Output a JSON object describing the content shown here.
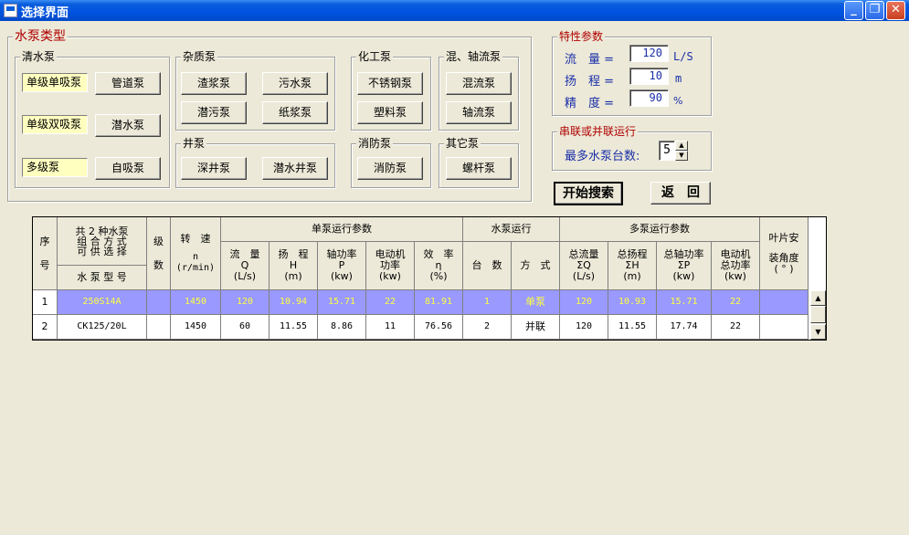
{
  "window": {
    "title": "选择界面",
    "min": "_",
    "max": "❐",
    "close": "✕"
  },
  "pump_type": {
    "title": "水泵类型",
    "clear_water": {
      "title": "清水泵",
      "single_stage_single_suction": "单级单吸泵",
      "single_stage_double_suction": "单级双吸泵",
      "multi_stage": "多级泵",
      "pipeline": "管道泵",
      "submersible": "潜水泵",
      "self_priming": "自吸泵"
    },
    "impurity": {
      "title": "杂质泵",
      "slag": "渣浆泵",
      "sewage": "污水泵",
      "submersible_sewage": "潜污泵",
      "paper_pulp": "纸浆泵"
    },
    "well": {
      "title": "井泵",
      "deep_well": "深井泵",
      "submersible_well": "潜水井泵"
    },
    "chemical": {
      "title": "化工泵",
      "stainless": "不锈钢泵",
      "plastic": "塑料泵"
    },
    "mixed_axial": {
      "title": "混、轴流泵",
      "mixed_flow": "混流泵",
      "axial_flow": "轴流泵"
    },
    "fire": {
      "title": "消防泵",
      "fire_pump": "消防泵"
    },
    "other": {
      "title": "其它泵",
      "screw": "螺杆泵"
    }
  },
  "params": {
    "title": "特性参数",
    "flow": {
      "label": "流　量 =",
      "value": "120",
      "unit": "L/S"
    },
    "head": {
      "label": "扬　程 =",
      "value": "10",
      "unit": "m"
    },
    "precision": {
      "label": "精　度 =",
      "value": "90",
      "unit": "%"
    }
  },
  "series": {
    "title": "串联或并联运行",
    "label": "最多水泵台数:",
    "value": "5"
  },
  "actions": {
    "search": "开始搜索",
    "back": "返　回"
  },
  "table": {
    "headers": {
      "seq_top": "序",
      "seq_bottom": "号",
      "combo": "共 2 种水泵\n组 合 方 式\n可 供 选 择",
      "model": "水 泵 型 号",
      "stage_top": "级",
      "stage_bottom": "数",
      "speed_top": "转　速",
      "speed_bottom": "n\n(r/min)",
      "single_group": "单泵运行参数",
      "single_cols": [
        "流　量\nQ\n(L/s)",
        "扬　程\nH\n(m)",
        "轴功率\nP\n(kw)",
        "电动机\n功率\n(kw)",
        "效　率\nη\n(%)"
      ],
      "run_group": "水泵运行",
      "run_cols": [
        "台　数",
        "方　式"
      ],
      "multi_group": "多泵运行参数",
      "multi_cols": [
        "总流量\nΣQ\n(L/s)",
        "总扬程\nΣH\n(m)",
        "总轴功率\nΣP\n(kw)",
        "电动机\n总功率\n(kw)"
      ],
      "blade_top": "叶片安",
      "blade_bottom": "装角度\n( ° )"
    },
    "rows": [
      [
        "1",
        "250S14A",
        "",
        "1450",
        "120",
        "10.94",
        "15.71",
        "22",
        "81.91",
        "1",
        "单泵",
        "120",
        "10.93",
        "15.71",
        "22",
        ""
      ],
      [
        "2",
        "CK125/20L",
        "",
        "1450",
        "60",
        "11.55",
        "8.86",
        "11",
        "76.56",
        "2",
        "并联",
        "120",
        "11.55",
        "17.74",
        "22",
        ""
      ]
    ]
  }
}
